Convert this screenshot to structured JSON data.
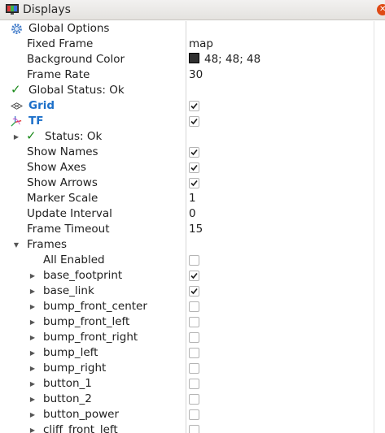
{
  "panel": {
    "title": "Displays",
    "close_glyph": "✕"
  },
  "global_options": {
    "label": "Global Options",
    "fixed_frame": {
      "label": "Fixed Frame",
      "value": "map"
    },
    "background_color": {
      "label": "Background Color",
      "value": "48; 48; 48",
      "swatch": "#303030"
    },
    "frame_rate": {
      "label": "Frame Rate",
      "value": "30"
    }
  },
  "global_status": {
    "label": "Global Status: Ok"
  },
  "grid": {
    "label": "Grid",
    "checked": true
  },
  "tf": {
    "label": "TF",
    "checked": true,
    "status": "Status: Ok",
    "show_names": {
      "label": "Show Names",
      "checked": true
    },
    "show_axes": {
      "label": "Show Axes",
      "checked": true
    },
    "show_arrows": {
      "label": "Show Arrows",
      "checked": true
    },
    "marker_scale": {
      "label": "Marker Scale",
      "value": "1"
    },
    "update_interval": {
      "label": "Update Interval",
      "value": "0"
    },
    "frame_timeout": {
      "label": "Frame Timeout",
      "value": "15"
    },
    "frames": {
      "label": "Frames",
      "all_enabled": {
        "label": "All Enabled",
        "checked": false
      },
      "items": [
        {
          "label": "base_footprint",
          "checked": true
        },
        {
          "label": "base_link",
          "checked": true
        },
        {
          "label": "bump_front_center",
          "checked": false
        },
        {
          "label": "bump_front_left",
          "checked": false
        },
        {
          "label": "bump_front_right",
          "checked": false
        },
        {
          "label": "bump_left",
          "checked": false
        },
        {
          "label": "bump_right",
          "checked": false
        },
        {
          "label": "button_1",
          "checked": false
        },
        {
          "label": "button_2",
          "checked": false
        },
        {
          "label": "button_power",
          "checked": false
        },
        {
          "label": "cliff_front_left",
          "checked": false
        }
      ]
    }
  },
  "colors": {
    "accent_blue": "#1d70c9",
    "ok_green": "#1a8a1a",
    "close_red": "#df4a16"
  }
}
